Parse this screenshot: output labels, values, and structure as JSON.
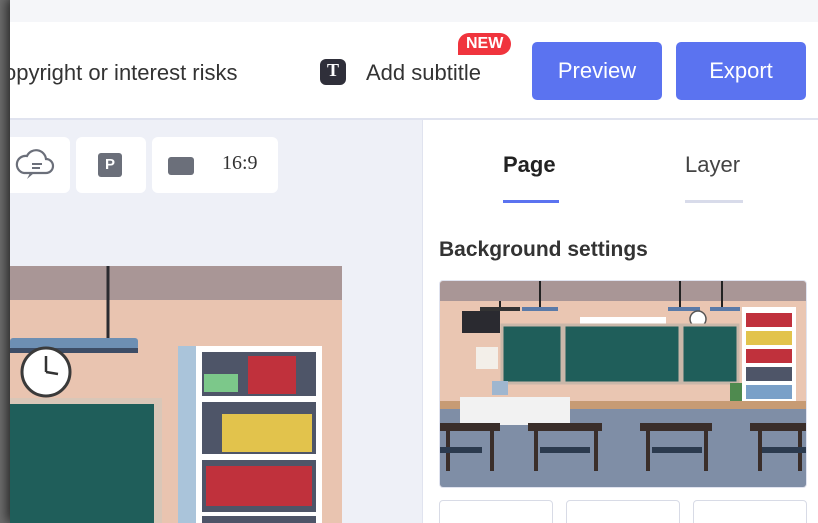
{
  "toolbar": {
    "copyright_text": "opyright or interest risks",
    "add_subtitle_label": "Add subtitle",
    "add_subtitle_icon_letter": "T",
    "new_badge": "NEW",
    "preview_label": "Preview",
    "export_label": "Export"
  },
  "canvas_tools": {
    "page_icon_letter": "P",
    "aspect_ratio": "16:9"
  },
  "panel": {
    "tabs": [
      {
        "label": "Page",
        "active": true
      },
      {
        "label": "Layer",
        "active": false
      }
    ],
    "background_title": "Background settings"
  },
  "colors": {
    "accent": "#5b73f0",
    "badge": "#f0343d",
    "chalkboard": "#1f5e5a"
  },
  "icons": {
    "subtitle": "text-t-icon",
    "cloud": "cloud-icon",
    "page": "page-p-icon",
    "ratio": "aspect-ratio-icon"
  }
}
